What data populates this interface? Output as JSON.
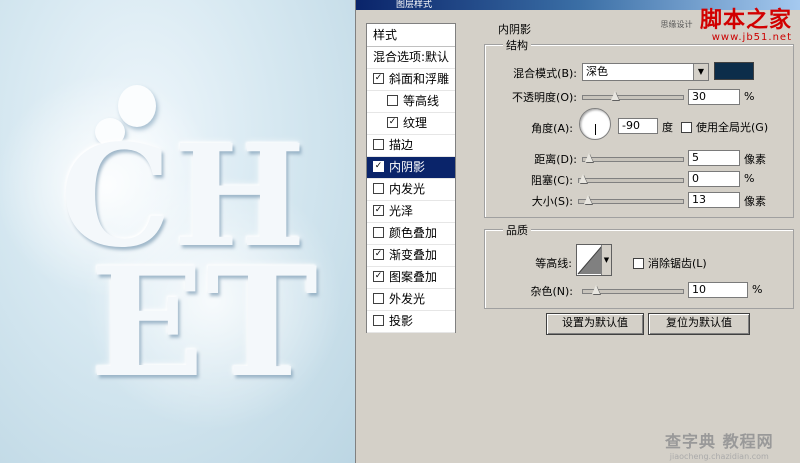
{
  "window": {
    "title": "图层样式"
  },
  "canvas": {
    "line1": "CH",
    "line2": "ET"
  },
  "styles_list": {
    "header": "样式",
    "blend_options": "混合选项:默认",
    "items": [
      {
        "label": "斜面和浮雕",
        "checked": true,
        "sub": false,
        "selected": false
      },
      {
        "label": "等高线",
        "checked": false,
        "sub": true,
        "selected": false
      },
      {
        "label": "纹理",
        "checked": true,
        "sub": true,
        "selected": false
      },
      {
        "label": "描边",
        "checked": false,
        "sub": false,
        "selected": false
      },
      {
        "label": "内阴影",
        "checked": true,
        "sub": false,
        "selected": true
      },
      {
        "label": "内发光",
        "checked": false,
        "sub": false,
        "selected": false
      },
      {
        "label": "光泽",
        "checked": true,
        "sub": false,
        "selected": false
      },
      {
        "label": "颜色叠加",
        "checked": false,
        "sub": false,
        "selected": false
      },
      {
        "label": "渐变叠加",
        "checked": true,
        "sub": false,
        "selected": false
      },
      {
        "label": "图案叠加",
        "checked": true,
        "sub": false,
        "selected": false
      },
      {
        "label": "外发光",
        "checked": false,
        "sub": false,
        "selected": false
      },
      {
        "label": "投影",
        "checked": false,
        "sub": false,
        "selected": false
      }
    ]
  },
  "panel": {
    "title": "内阴影",
    "structure": {
      "title": "结构",
      "blend_mode_label": "混合模式(B):",
      "blend_mode_value": "深色",
      "blend_color": "#0c2d4a",
      "opacity_label": "不透明度(O):",
      "opacity_value": "30",
      "opacity_unit": "%",
      "opacity_level": 0.3,
      "angle_label": "角度(A):",
      "angle_value": "-90",
      "angle_unit": "度",
      "global_light_label": "使用全局光(G)",
      "global_light_checked": false,
      "distance_label": "距离(D):",
      "distance_value": "5",
      "distance_unit": "像素",
      "distance_level": 0.02,
      "choke_label": "阻塞(C):",
      "choke_value": "0",
      "choke_unit": "%",
      "choke_level": 0.0,
      "size_label": "大小(S):",
      "size_value": "13",
      "size_unit": "像素",
      "size_level": 0.05
    },
    "quality": {
      "title": "品质",
      "contour_label": "等高线:",
      "antialias_label": "消除锯齿(L)",
      "antialias_checked": false,
      "noise_label": "杂色(N):",
      "noise_value": "10",
      "noise_unit": "%",
      "noise_level": 0.1
    },
    "buttons": {
      "make_default": "设置为默认值",
      "reset_default": "复位为默认值"
    }
  },
  "watermarks": {
    "site_top": "思缘设计",
    "brand": "脚本之家",
    "brand_url": "www.jb51.net",
    "bottom": "查字典 教程网",
    "bottom_url": "jiaocheng.chazidian.com"
  }
}
